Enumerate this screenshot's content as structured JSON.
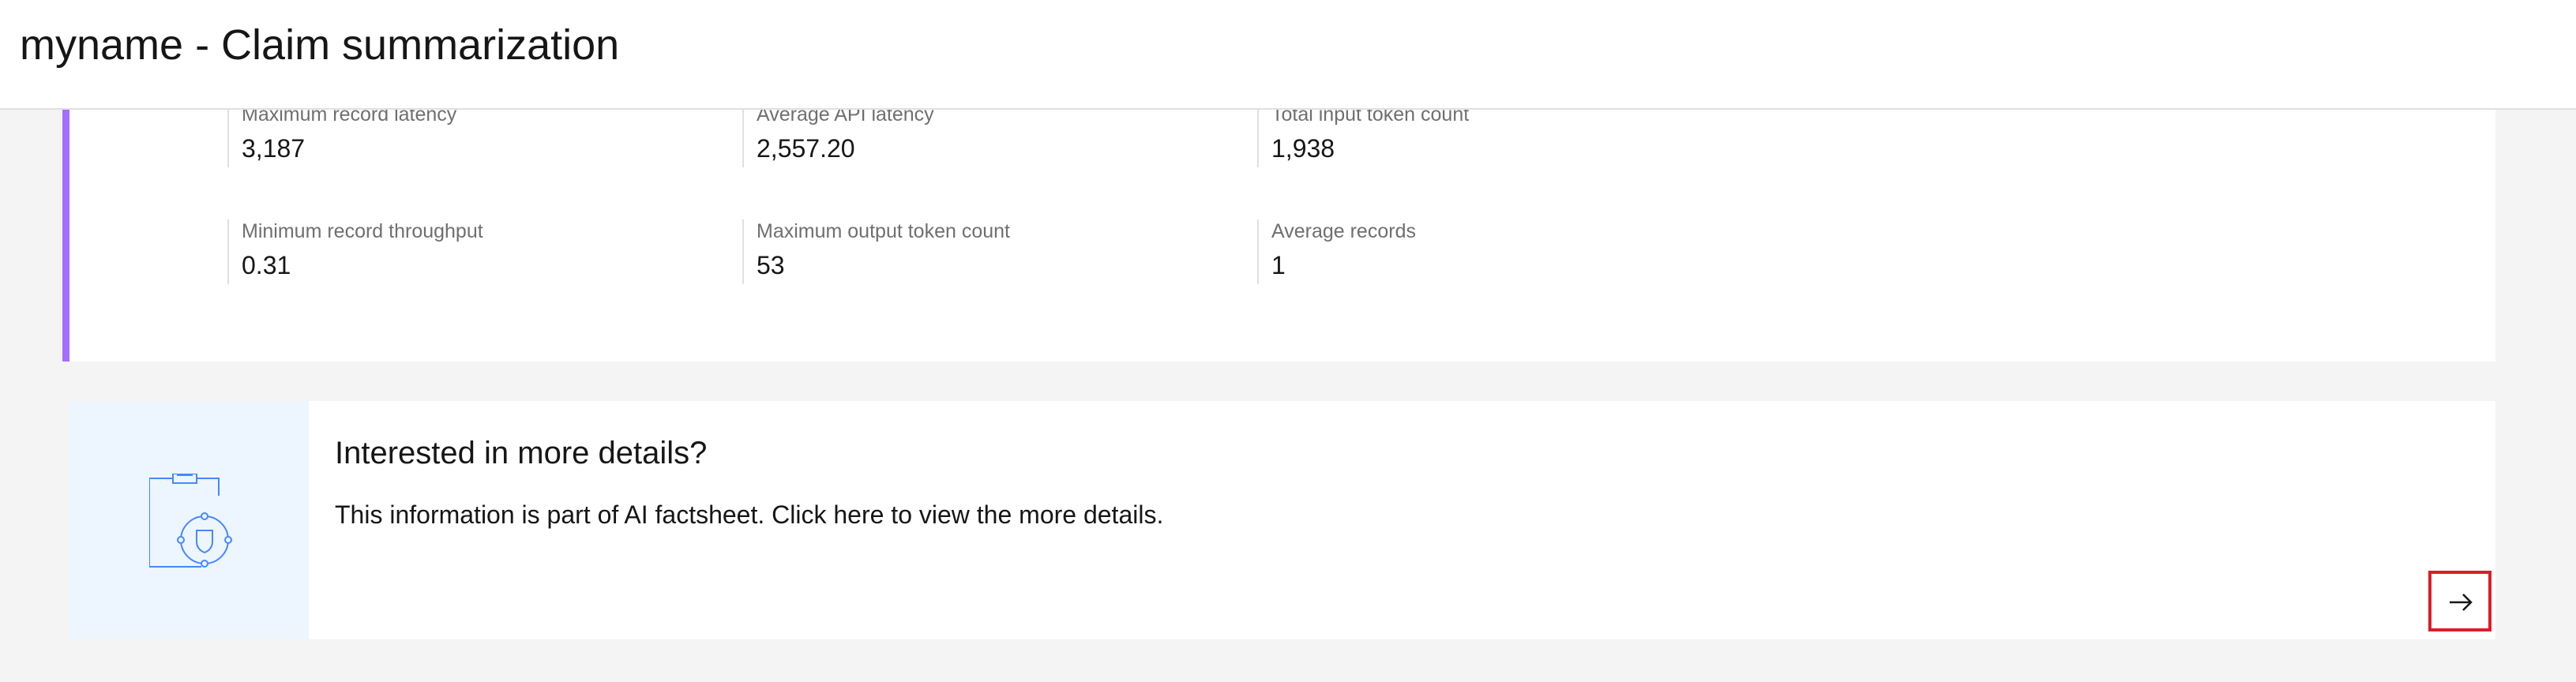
{
  "header": {
    "title": "myname - Claim summarization"
  },
  "metrics": [
    {
      "label": "Maximum record latency",
      "value": "3,187"
    },
    {
      "label": "Average API latency",
      "value": "2,557.20"
    },
    {
      "label": "Total input token count",
      "value": "1,938"
    },
    {
      "label": "Minimum record throughput",
      "value": "0.31"
    },
    {
      "label": "Maximum output token count",
      "value": "53"
    },
    {
      "label": "Average records",
      "value": "1"
    }
  ],
  "details": {
    "title": "Interested in more details?",
    "body": "This information is part of AI factsheet. Click here to view the more details.",
    "illustration_icon": "clipboard-shield-icon",
    "action_icon": "arrow-right-icon"
  },
  "colors": {
    "accent_purple": "#a56eff",
    "illustration_bg": "#edf5ff",
    "illustration_stroke": "#4589ff",
    "highlight_red": "#da1e28",
    "page_bg": "#f4f4f4"
  }
}
